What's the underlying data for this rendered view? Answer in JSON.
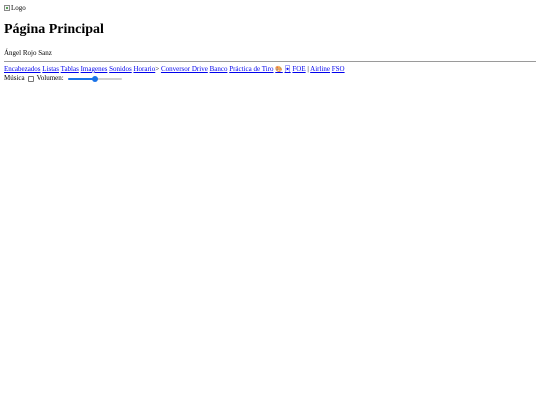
{
  "header": {
    "logo_alt": "Logo",
    "title": "Página Principal",
    "author": "Ángel Rojo Sanz"
  },
  "nav": {
    "links": [
      "Encabezados",
      "Listas",
      "Tablas",
      "Imagenes",
      "Sonidos",
      "Horario",
      "Conversor Drive",
      "Banco",
      "Práctica de Tiro",
      "🎨",
      "🃏",
      "FOE",
      "Airline",
      "FSO"
    ],
    "separator_after_horario": ">",
    "separator_between_foe_airline": "|"
  },
  "controls": {
    "music_label": "Música",
    "music_checked": false,
    "volume_label": "Volumen:",
    "volume_level": 0.5
  },
  "colors": {
    "link": "#0000ee",
    "slider_accent": "#1a73e8",
    "rule": "#9a9a9a"
  }
}
